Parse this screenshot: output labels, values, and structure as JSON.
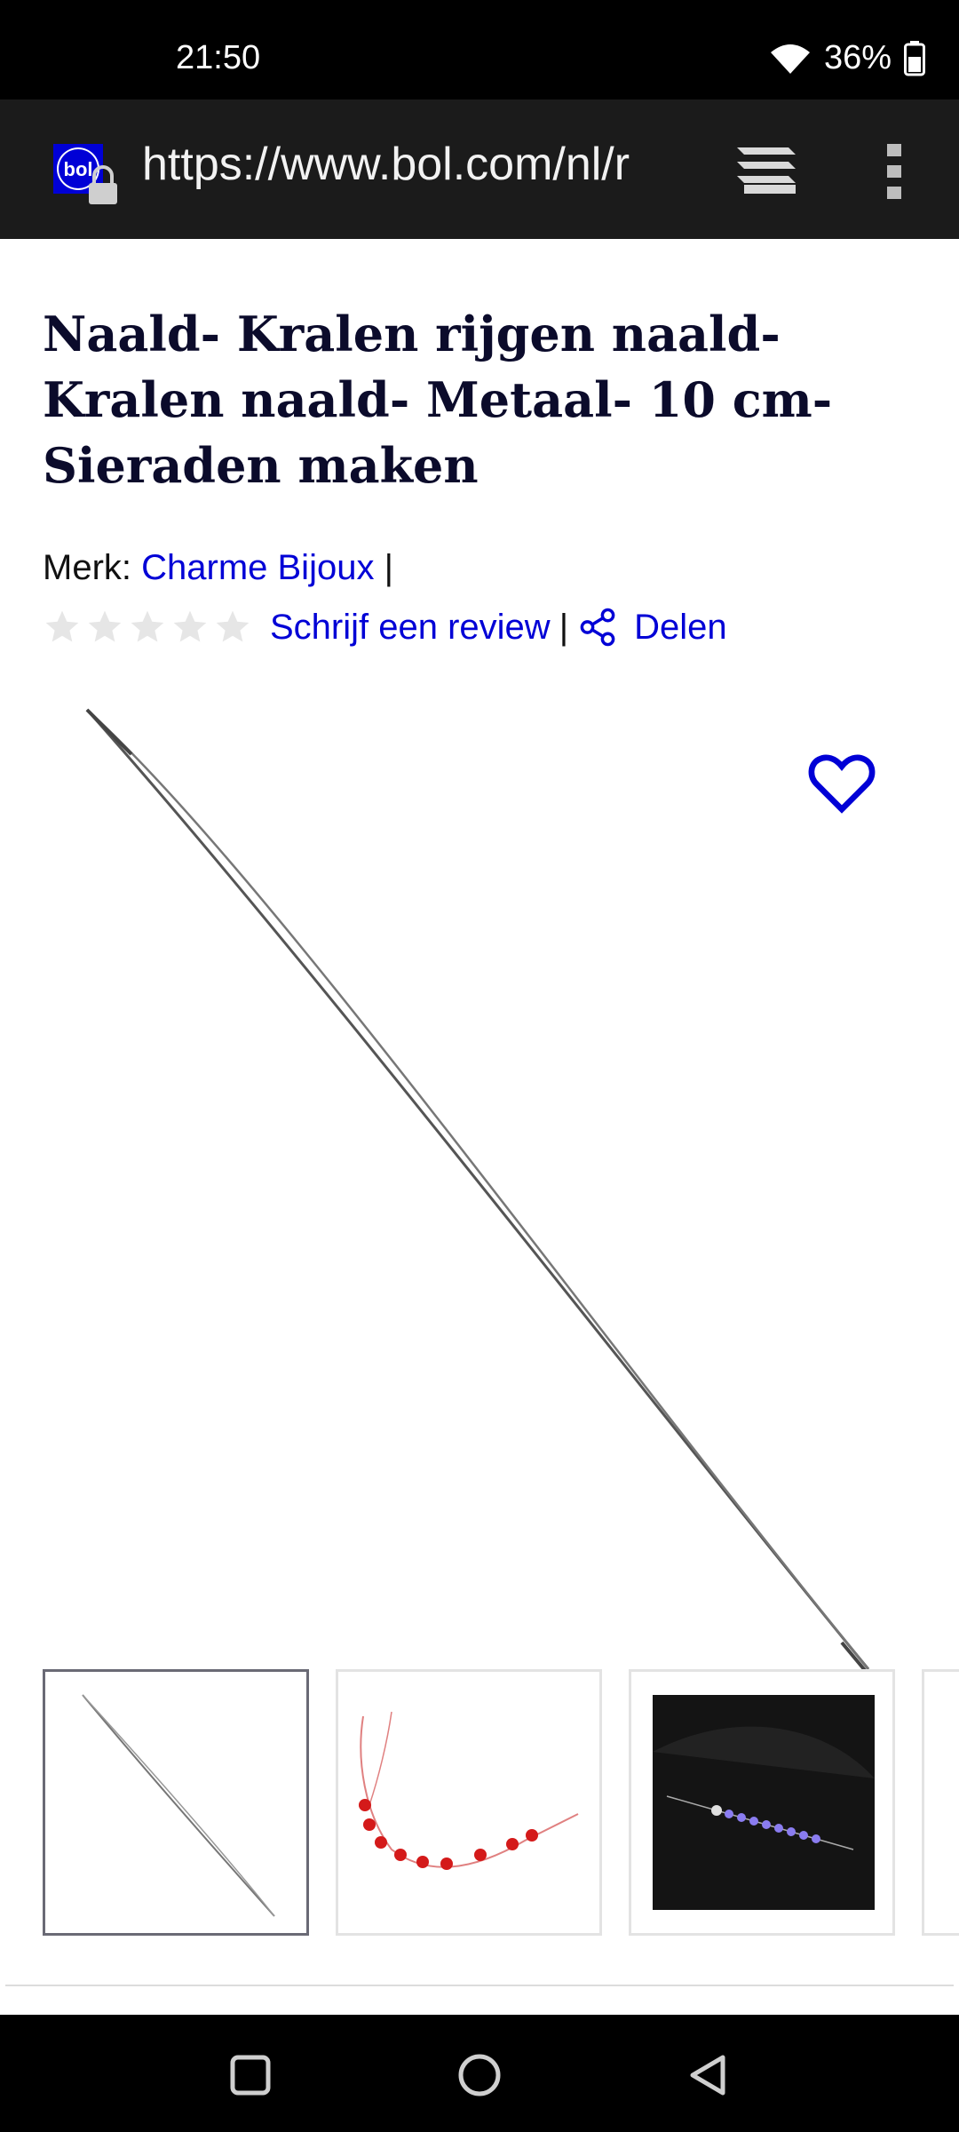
{
  "status": {
    "time": "21:50",
    "battery": "36%",
    "wifi_icon": "wifi-icon",
    "battery_icon": "battery-icon"
  },
  "browser": {
    "url": "https://www.bol.com/nl/r",
    "site_icon_text": "bol"
  },
  "product": {
    "title": "Naald- Kralen rijgen naald- Kralen naald- Metaal- 10 cm- Sieraden maken",
    "brand_label": "Merk: ",
    "brand_name": "Charme Bijoux",
    "separator": "|",
    "review_link": "Schrijf een review",
    "share_label": "Delen",
    "rating": 0,
    "rating_max": 5
  },
  "colors": {
    "link": "#0000d6",
    "title": "#0b0b2b",
    "star_empty": "#e6e6e6"
  }
}
